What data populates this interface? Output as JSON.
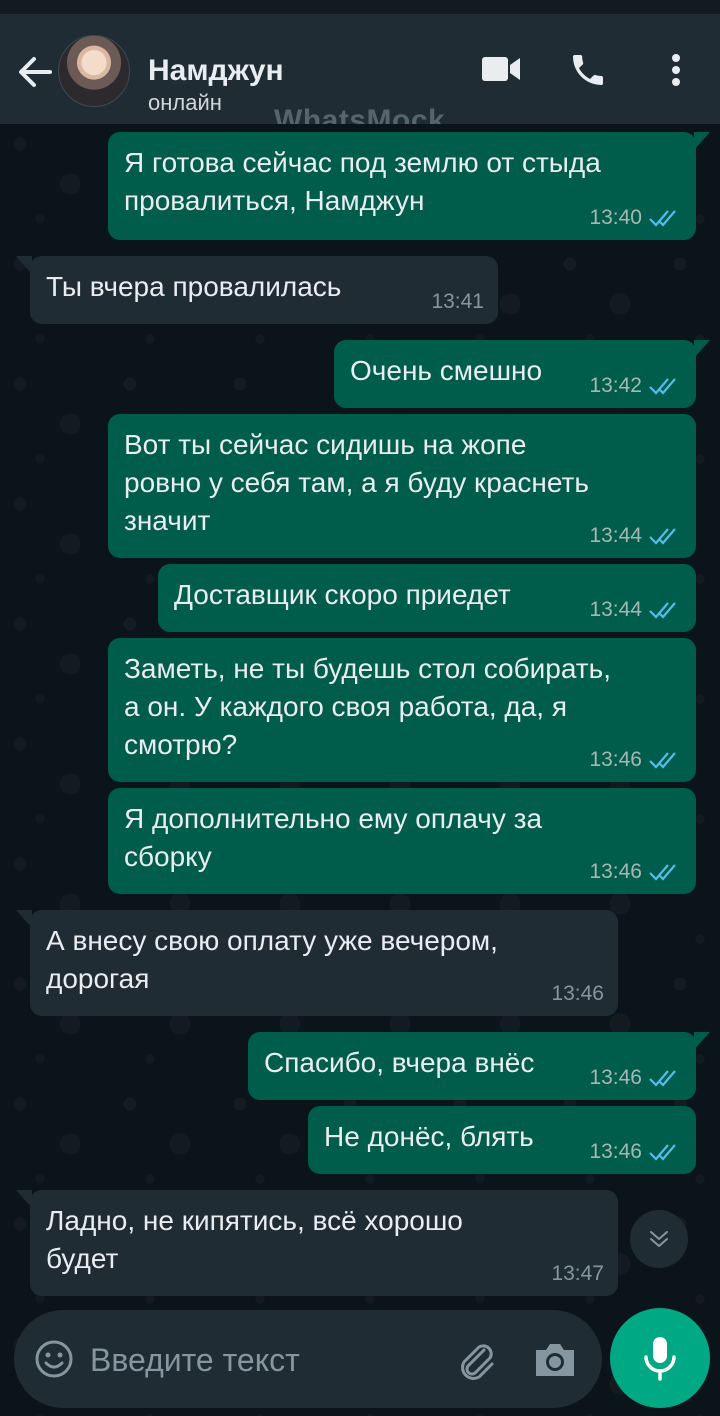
{
  "header": {
    "name": "Намджун",
    "status": "онлайн",
    "watermark": "WhatsMock",
    "icons": [
      "back-arrow-icon",
      "video-call-icon",
      "voice-call-icon",
      "more-options-icon"
    ]
  },
  "messages": [
    {
      "direction": "out",
      "text": "Я готова сейчас под землю от стыда\nпровалиться, Намджун",
      "time": "13:40",
      "read": true
    },
    {
      "direction": "in",
      "text": "Ты вчера провалилась",
      "time": "13:41"
    },
    {
      "direction": "out",
      "text": "Очень смешно",
      "time": "13:42",
      "read": true
    },
    {
      "direction": "out",
      "text": "Вот ты сейчас сидишь на жопе\nровно у себя там, а я буду краснеть\nзначит",
      "time": "13:44",
      "read": true
    },
    {
      "direction": "out",
      "text": "Доставщик скоро приедет",
      "time": "13:44",
      "read": true
    },
    {
      "direction": "out",
      "text": "Заметь, не ты будешь стол собирать,\nа он. У каждого своя работа, да, я\nсмотрю?",
      "time": "13:46",
      "read": true
    },
    {
      "direction": "out",
      "text": "Я дополнительно ему оплачу за\nсборку",
      "time": "13:46",
      "read": true
    },
    {
      "direction": "in",
      "text": "А внесу свою оплату уже вечером,\nдорогая",
      "time": "13:46"
    },
    {
      "direction": "out",
      "text": "Спасибо, вчера внёс",
      "time": "13:46",
      "read": true
    },
    {
      "direction": "out",
      "text": "Не донёс, блять",
      "time": "13:46",
      "read": true
    },
    {
      "direction": "in",
      "text": "Ладно, не кипятись, всё хорошо\nбудет",
      "time": "13:47"
    }
  ],
  "input": {
    "placeholder": "Введите текст",
    "icons": [
      "emoji-icon",
      "attach-icon",
      "camera-icon",
      "mic-icon"
    ]
  },
  "colors": {
    "background": "#0b141a",
    "header": "#202c33",
    "outgoing_bubble": "#005c4b",
    "incoming_bubble": "#202c33",
    "read_ticks": "#53bdeb",
    "accent": "#00a884"
  }
}
